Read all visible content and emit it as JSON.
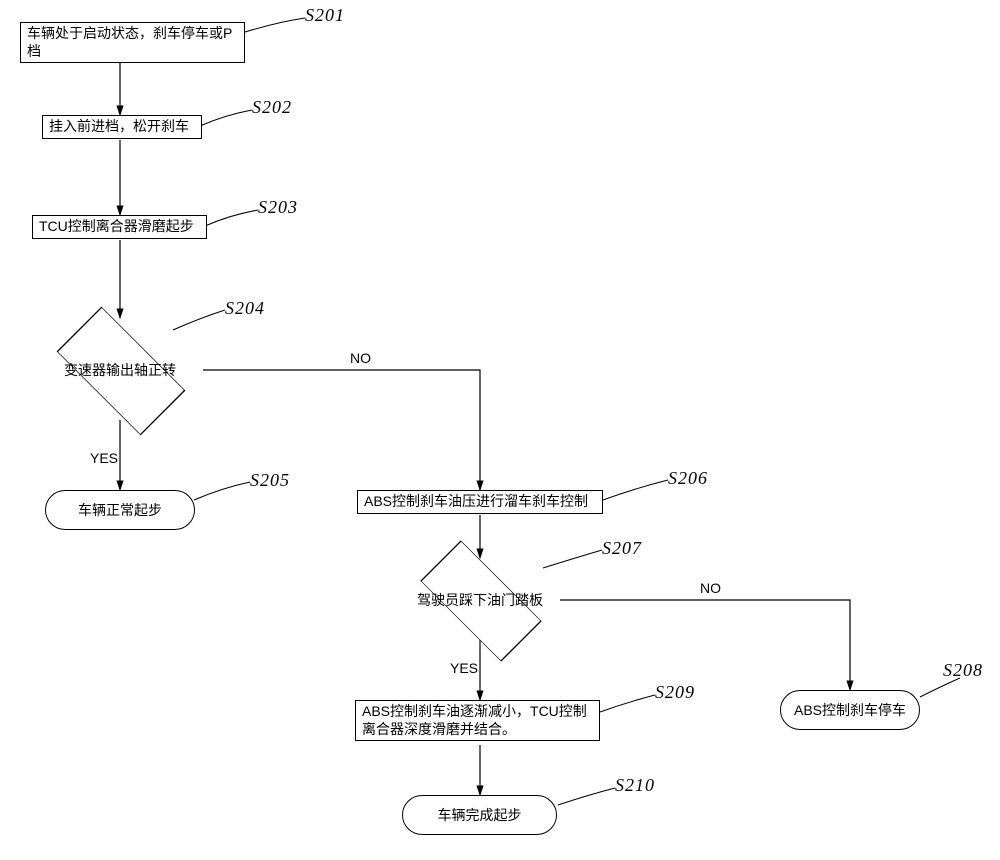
{
  "steps": {
    "s201": {
      "id": "S201",
      "text": "车辆处于启动状态，刹车停车或P档"
    },
    "s202": {
      "id": "S202",
      "text": "挂入前进档，松开刹车"
    },
    "s203": {
      "id": "S203",
      "text": "TCU控制离合器滑磨起步"
    },
    "s204": {
      "id": "S204",
      "text": "变速器输出轴正转"
    },
    "s205": {
      "id": "S205",
      "text": "车辆正常起步"
    },
    "s206": {
      "id": "S206",
      "text": "ABS控制刹车油压进行溜车刹车控制"
    },
    "s207": {
      "id": "S207",
      "text": "驾驶员踩下油门踏板"
    },
    "s208": {
      "id": "S208",
      "text": "ABS控制刹车停车"
    },
    "s209": {
      "id": "S209",
      "text": "ABS控制刹车油逐渐减小，TCU控制离合器深度滑磨并结合。"
    },
    "s210": {
      "id": "S210",
      "text": "车辆完成起步"
    }
  },
  "edge_labels": {
    "yes": "YES",
    "no": "NO"
  }
}
